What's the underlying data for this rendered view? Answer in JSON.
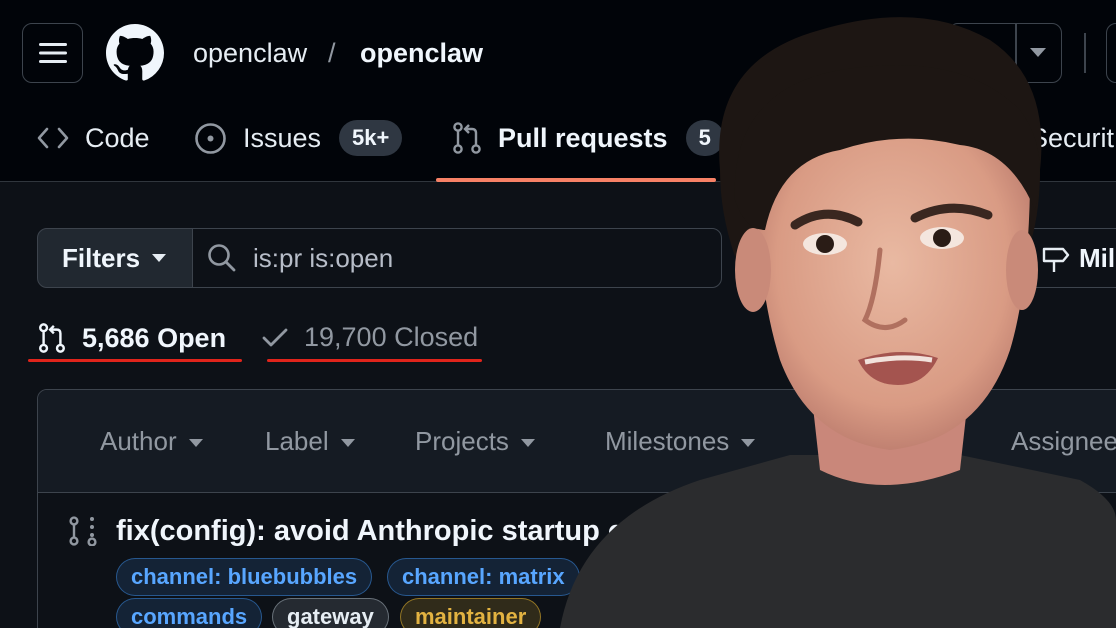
{
  "header": {
    "owner": "openclaw",
    "separator": "/",
    "repo": "openclaw"
  },
  "tabs": [
    {
      "icon": "code-icon",
      "label": "Code"
    },
    {
      "icon": "issue-opened-icon",
      "label": "Issues",
      "count": "5k+"
    },
    {
      "icon": "git-pull-request-icon",
      "label": "Pull requests",
      "count": "5"
    },
    {
      "icon": "shield-icon",
      "label": "Securit"
    }
  ],
  "filter_bar": {
    "filters_label": "Filters",
    "search_value": "is:pr is:open",
    "milestones_label": "Mile"
  },
  "state": {
    "open_label": "5,686 Open",
    "closed_label": "19,700 Closed"
  },
  "list_header": {
    "filters": [
      "Author",
      "Label",
      "Projects",
      "Milestones",
      "Assignee"
    ]
  },
  "pr": {
    "title": "fix(config): avoid Anthropic startup crash",
    "labels": [
      {
        "text": "channel: bluebubbles",
        "color": "#3b8eea"
      },
      {
        "text": "channel: matrix",
        "color": "#3b8eea"
      },
      {
        "text": "commands",
        "color": "#3b8eea"
      },
      {
        "text": "gateway",
        "color": "#6e7681"
      },
      {
        "text": "maintainer",
        "color": "#d4a72c"
      }
    ]
  },
  "colors": {
    "background": "#0d1117",
    "header": "#010409",
    "accent_underline": "#f78166",
    "annotation_red": "#e0241b"
  }
}
